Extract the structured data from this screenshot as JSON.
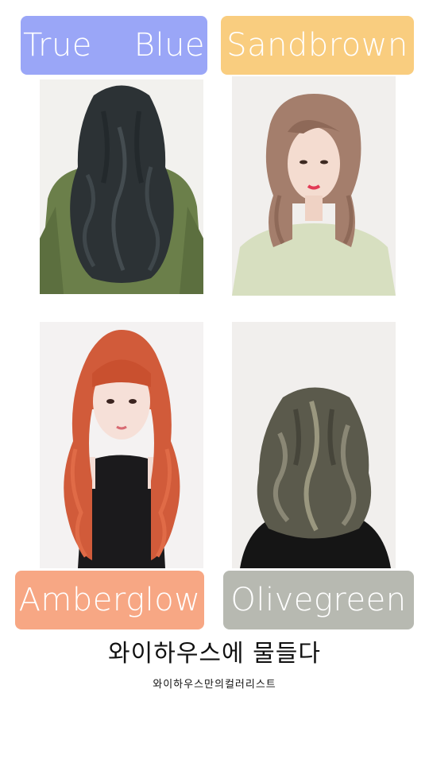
{
  "swatches": [
    {
      "label": "True    Blue",
      "color": "#9aa6f7"
    },
    {
      "label": "Sandbrown",
      "color": "#f9cd7f"
    },
    {
      "label": "Amberglow",
      "color": "#f7a784"
    },
    {
      "label": "Olivegreen",
      "color": "#b7b9b1"
    }
  ],
  "headline": "와이하우스에 물들다",
  "subline": "와이하우스만의컬러리스트"
}
